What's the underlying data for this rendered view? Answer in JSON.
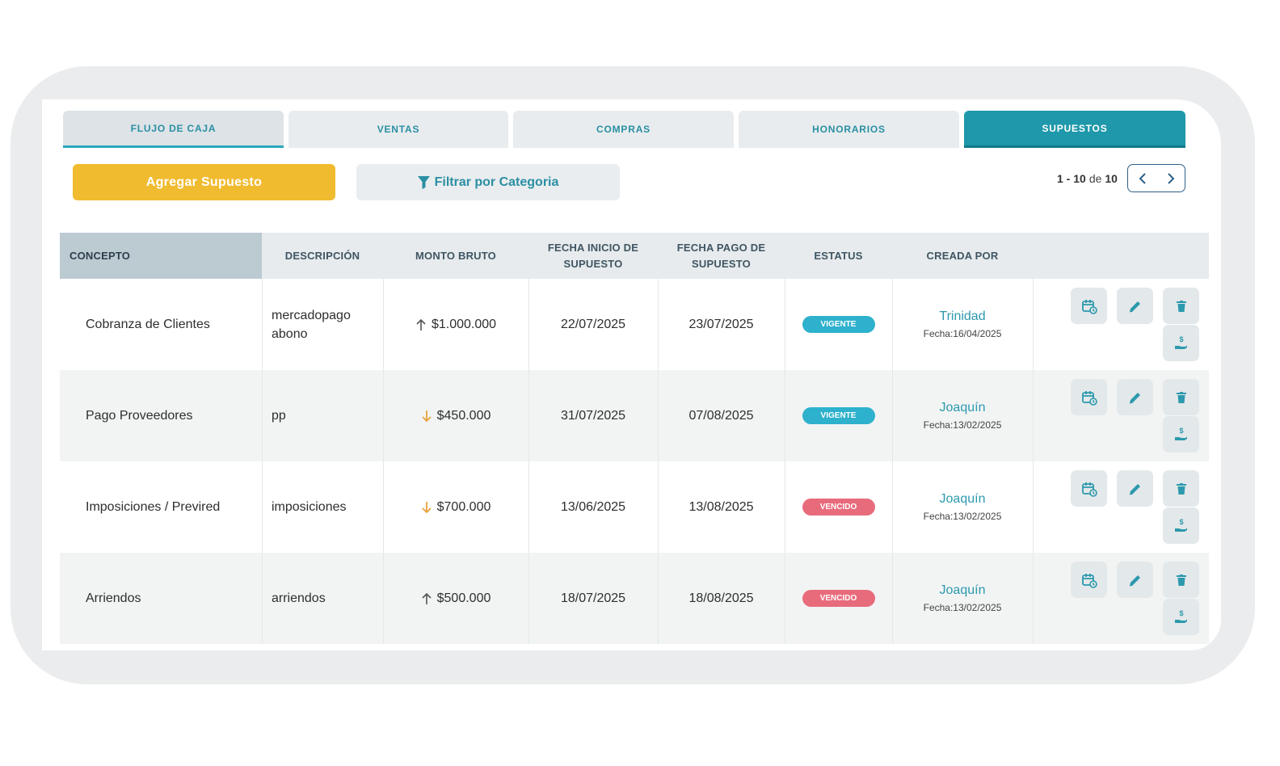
{
  "tabs": [
    {
      "label": "FLUJO DE CAJA"
    },
    {
      "label": "VENTAS"
    },
    {
      "label": "COMPRAS"
    },
    {
      "label": "HONORARIOS"
    },
    {
      "label": "SUPUESTOS"
    }
  ],
  "toolbar": {
    "add_label": "Agregar Supuesto",
    "filter_label": "Filtrar por Categoria"
  },
  "pagination": {
    "range": "1 - 10",
    "of": "de",
    "total": "10"
  },
  "columns": {
    "concepto": "CONCEPTO",
    "descripcion": "DESCRIPCIÓN",
    "monto": "MONTO BRUTO",
    "fecha_inicio_1": "FECHA INICIO DE",
    "fecha_inicio_2": "SUPUESTO",
    "fecha_pago_1": "FECHA PAGO DE",
    "fecha_pago_2": "SUPUESTO",
    "estatus": "ESTATUS",
    "creada": "CREADA POR"
  },
  "rows": [
    {
      "concepto": "Cobranza de Clientes",
      "descripcion": "mercadopago abono",
      "monto": "$1.000.000",
      "direction": "up",
      "fecha_inicio": "22/07/2025",
      "fecha_pago": "23/07/2025",
      "estatus": "VIGENTE",
      "creador": "Trinidad",
      "fecha_creacion": "Fecha:16/04/2025"
    },
    {
      "concepto": "Pago Proveedores",
      "descripcion": "pp",
      "monto": "$450.000",
      "direction": "down",
      "fecha_inicio": "31/07/2025",
      "fecha_pago": "07/08/2025",
      "estatus": "VIGENTE",
      "creador": "Joaquín",
      "fecha_creacion": "Fecha:13/02/2025"
    },
    {
      "concepto": "Imposiciones / Previred",
      "descripcion": "imposiciones",
      "monto": "$700.000",
      "direction": "down",
      "fecha_inicio": "13/06/2025",
      "fecha_pago": "13/08/2025",
      "estatus": "VENCIDO",
      "creador": "Joaquín",
      "fecha_creacion": "Fecha:13/02/2025"
    },
    {
      "concepto": "Arriendos",
      "descripcion": "arriendos",
      "monto": "$500.000",
      "direction": "up",
      "fecha_inicio": "18/07/2025",
      "fecha_pago": "18/08/2025",
      "estatus": "VENCIDO",
      "creador": "Joaquín",
      "fecha_creacion": "Fecha:13/02/2025"
    }
  ],
  "icons": {
    "filter": "filter-icon",
    "prev": "chevron-left-icon",
    "next": "chevron-right-icon",
    "arrow_up": "arrow-up-icon",
    "arrow_down": "arrow-down-icon",
    "reschedule": "calendar-repeat-icon",
    "edit": "pencil-icon",
    "delete": "trash-icon",
    "pay": "hand-money-icon"
  },
  "colors": {
    "accent": "#1e98aa",
    "add_button": "#f1bb2f",
    "status_vigente": "#2eb1cc",
    "status_vencido": "#e86b7c",
    "arrow_down": "#e9a23b",
    "arrow_up": "#555555"
  }
}
